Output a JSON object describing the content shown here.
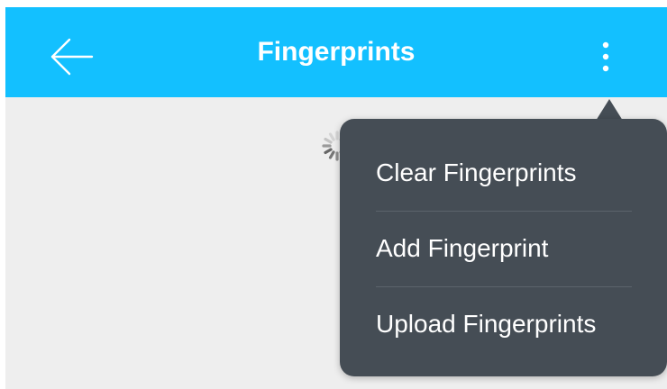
{
  "header": {
    "title": "Fingerprints",
    "back_icon": "arrow-left-icon",
    "more_icon": "more-vertical-icon"
  },
  "main": {
    "loading_icon": "spinner-icon"
  },
  "menu": {
    "items": [
      {
        "label": "Clear Fingerprints"
      },
      {
        "label": "Add Fingerprint"
      },
      {
        "label": "Upload Fingerprints"
      }
    ]
  },
  "colors": {
    "app_bar": "#13c0ff",
    "background": "#eeeeee",
    "menu_background": "#454d55",
    "text_on_dark": "#ffffff"
  }
}
